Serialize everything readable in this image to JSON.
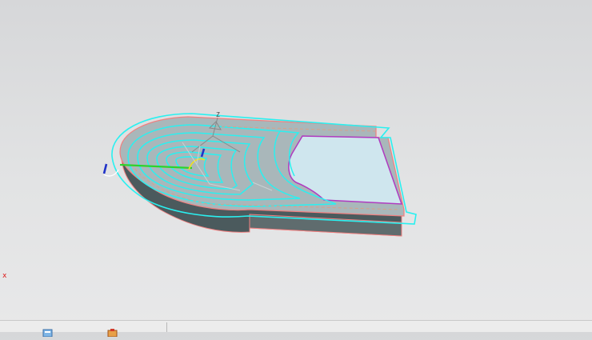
{
  "viewport": {
    "triad_axis_x": "x",
    "wcs_axis_z": "Z",
    "part": "pocket-toolpath-model"
  },
  "colors": {
    "background_top": "#d6d7d9",
    "background_bottom": "#e8e8e9",
    "toolpath": "#2af0f0",
    "part_edge": "#f08080",
    "part_side": "#4b5a5d",
    "part_top": "#a9b7ba",
    "pocket_floor": "#cfe6ee",
    "pocket_wall": "#b03ac0",
    "approach_path": "#2cd42c",
    "tool_marker": "#2032c8",
    "axis_x": "#dd1111"
  },
  "statusbar": {
    "icons": [
      "part-navigator-icon",
      "operation-navigator-icon"
    ]
  }
}
